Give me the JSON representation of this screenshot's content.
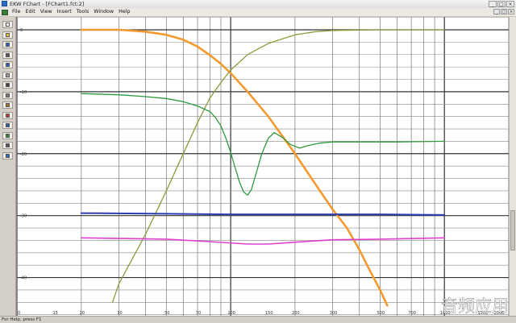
{
  "window": {
    "title": "EKW FChart - [FChart1.fct:2]",
    "minimize": "_",
    "maximize": "□",
    "close": "×"
  },
  "menu": {
    "items": [
      "File",
      "Edit",
      "View",
      "Insert",
      "Tools",
      "Window",
      "Help"
    ]
  },
  "toolbar": {
    "icons": [
      "new-document-icon",
      "open-folder-icon",
      "save-icon",
      "cut-icon",
      "copy-icon",
      "paste-icon",
      "print-icon",
      "zoom-icon",
      "pen-icon",
      "eraser-icon",
      "line-tool-icon",
      "curve-tool-icon",
      "fill-tool-icon",
      "help-icon"
    ]
  },
  "status": {
    "text": "For Help, press F1"
  },
  "watermark": {
    "text": "音频应用"
  },
  "colors": {
    "orange": "#f39a2e",
    "olive": "#8f9a3c",
    "green": "#2f9a3c",
    "blue": "#2b3fb5",
    "magenta": "#e040d0",
    "grid": "#555555"
  },
  "chart_data": {
    "type": "line",
    "x_scale": "log",
    "xlim": [
      10,
      2000
    ],
    "ylim": [
      -45,
      0
    ],
    "grid": true,
    "x_tick_labels": [
      {
        "x": 10,
        "label": "10"
      },
      {
        "x": 15,
        "label": "15"
      },
      {
        "x": 20,
        "label": "20"
      },
      {
        "x": 30,
        "label": "30"
      },
      {
        "x": 50,
        "label": "50"
      },
      {
        "x": 70,
        "label": "70"
      },
      {
        "x": 100,
        "label": "100"
      },
      {
        "x": 150,
        "label": "150"
      },
      {
        "x": 200,
        "label": "200"
      },
      {
        "x": 300,
        "label": "300"
      },
      {
        "x": 500,
        "label": "500"
      },
      {
        "x": 700,
        "label": "700"
      },
      {
        "x": 1000,
        "label": "1000"
      },
      {
        "x": 1500,
        "label": "1500"
      },
      {
        "x": 2000,
        "label": "2000"
      }
    ],
    "y_tick_labels": [
      {
        "y": 0,
        "label": "0"
      },
      {
        "y": -10,
        "label": "-10"
      },
      {
        "y": -20,
        "label": "-20"
      },
      {
        "y": -30,
        "label": "-30"
      },
      {
        "y": -40,
        "label": "-40"
      }
    ],
    "series": [
      {
        "color": "#f39a2e",
        "width": 2.6,
        "points": [
          [
            20,
            0
          ],
          [
            30,
            0
          ],
          [
            40,
            -0.3
          ],
          [
            50,
            -0.8
          ],
          [
            60,
            -1.6
          ],
          [
            70,
            -2.7
          ],
          [
            80,
            -4.1
          ],
          [
            90,
            -5.5
          ],
          [
            100,
            -7
          ],
          [
            120,
            -10
          ],
          [
            150,
            -14
          ],
          [
            200,
            -20
          ],
          [
            250,
            -25
          ],
          [
            300,
            -29
          ],
          [
            350,
            -32
          ],
          [
            400,
            -35.5
          ],
          [
            450,
            -39
          ],
          [
            500,
            -42
          ],
          [
            540,
            -44.5
          ]
        ]
      },
      {
        "color": "#8f9a3c",
        "width": 1.3,
        "points": [
          [
            28,
            -44
          ],
          [
            30,
            -41
          ],
          [
            40,
            -33
          ],
          [
            50,
            -26
          ],
          [
            60,
            -20
          ],
          [
            70,
            -15
          ],
          [
            80,
            -11
          ],
          [
            90,
            -8.5
          ],
          [
            100,
            -6.5
          ],
          [
            120,
            -4
          ],
          [
            150,
            -2.2
          ],
          [
            200,
            -0.8
          ],
          [
            250,
            -0.3
          ],
          [
            300,
            -0.1
          ],
          [
            500,
            0
          ],
          [
            1000,
            0
          ]
        ]
      },
      {
        "color": "#2f9a3c",
        "width": 1.3,
        "points": [
          [
            20,
            -10.3
          ],
          [
            30,
            -10.5
          ],
          [
            40,
            -10.8
          ],
          [
            50,
            -11.1
          ],
          [
            60,
            -11.6
          ],
          [
            70,
            -12.3
          ],
          [
            80,
            -13.2
          ],
          [
            85,
            -14.2
          ],
          [
            90,
            -15.5
          ],
          [
            95,
            -17.5
          ],
          [
            100,
            -19.8
          ],
          [
            105,
            -22.3
          ],
          [
            110,
            -24.6
          ],
          [
            115,
            -26.2
          ],
          [
            120,
            -26.7
          ],
          [
            125,
            -25.8
          ],
          [
            130,
            -23.8
          ],
          [
            140,
            -20
          ],
          [
            150,
            -17.5
          ],
          [
            160,
            -16.6
          ],
          [
            175,
            -17.4
          ],
          [
            190,
            -18.5
          ],
          [
            210,
            -19.1
          ],
          [
            230,
            -18.7
          ],
          [
            260,
            -18.3
          ],
          [
            300,
            -18.1
          ],
          [
            400,
            -18.1
          ],
          [
            600,
            -18.1
          ],
          [
            1000,
            -18.0
          ]
        ]
      },
      {
        "color": "#2b3fb5",
        "width": 2.0,
        "points": [
          [
            20,
            -29.6
          ],
          [
            50,
            -29.7
          ],
          [
            100,
            -29.8
          ],
          [
            200,
            -29.8
          ],
          [
            500,
            -29.8
          ],
          [
            1000,
            -29.9
          ]
        ]
      },
      {
        "color": "#e040d0",
        "width": 1.6,
        "points": [
          [
            20,
            -33.6
          ],
          [
            50,
            -33.8
          ],
          [
            80,
            -34.2
          ],
          [
            120,
            -34.6
          ],
          [
            150,
            -34.6
          ],
          [
            200,
            -34.3
          ],
          [
            300,
            -33.9
          ],
          [
            500,
            -33.8
          ],
          [
            1000,
            -33.6
          ]
        ]
      }
    ]
  }
}
